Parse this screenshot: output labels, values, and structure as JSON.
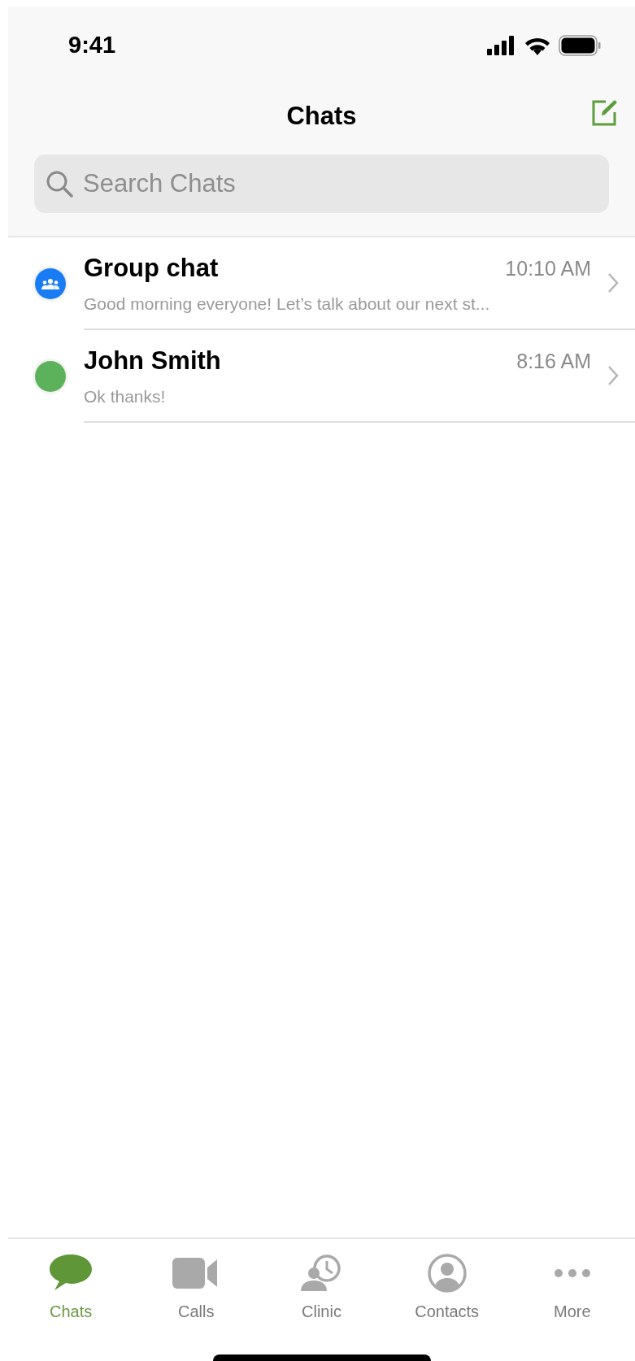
{
  "status_bar": {
    "time": "9:41"
  },
  "header": {
    "title": "Chats"
  },
  "search": {
    "placeholder": "Search Chats"
  },
  "chats": [
    {
      "name": "Group chat",
      "time": "10:10 AM",
      "preview": "Good morning everyone! Let’s talk about our next st...",
      "kind": "group",
      "color": "#1a7cf5"
    },
    {
      "name": "John Smith",
      "time": "8:16 AM",
      "preview": "Ok thanks!",
      "kind": "person",
      "color": "#5cb25a"
    }
  ],
  "tabs": [
    {
      "label": "Chats",
      "kind": "chats",
      "selected": true
    },
    {
      "label": "Calls",
      "kind": "calls",
      "selected": false
    },
    {
      "label": "Clinic",
      "kind": "clinic",
      "selected": false
    },
    {
      "label": "Contacts",
      "kind": "contacts",
      "selected": false
    },
    {
      "label": "More",
      "kind": "more",
      "selected": false
    }
  ]
}
